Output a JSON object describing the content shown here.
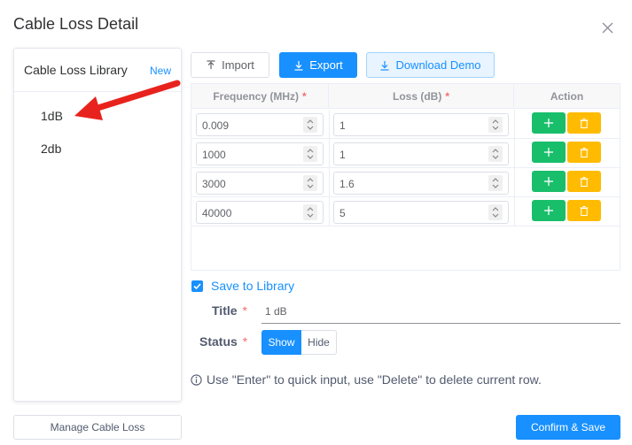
{
  "dialog": {
    "title": "Cable Loss Detail"
  },
  "library": {
    "title": "Cable Loss Library",
    "new_label": "New",
    "items": [
      {
        "label": "1dB"
      },
      {
        "label": "2db"
      }
    ]
  },
  "toolbar": {
    "import_label": "Import",
    "export_label": "Export",
    "download_demo_label": "Download Demo"
  },
  "table": {
    "headers": {
      "frequency": "Frequency (MHz)",
      "loss": "Loss (dB)",
      "action": "Action",
      "required_mark": "*"
    },
    "rows": [
      {
        "frequency": "0.009",
        "loss": "1"
      },
      {
        "frequency": "1000",
        "loss": "1"
      },
      {
        "frequency": "3000",
        "loss": "1.6"
      },
      {
        "frequency": "40000",
        "loss": "5"
      }
    ]
  },
  "form": {
    "save_to_library_label": "Save to Library",
    "save_to_library_checked": true,
    "title_label": "Title",
    "title_value": "1 dB",
    "required_mark": "*",
    "status_label": "Status",
    "status_options": [
      "Show",
      "Hide"
    ],
    "status_selected": "Show"
  },
  "hint_text": "Use \"Enter\" to quick input, use \"Delete\" to delete current row.",
  "footer": {
    "manage_label": "Manage Cable Loss",
    "confirm_label": "Confirm & Save"
  },
  "colors": {
    "primary": "#1890ff",
    "success": "#19be6b",
    "warning": "#ffbb00",
    "annotation_arrow": "#e8231e"
  }
}
